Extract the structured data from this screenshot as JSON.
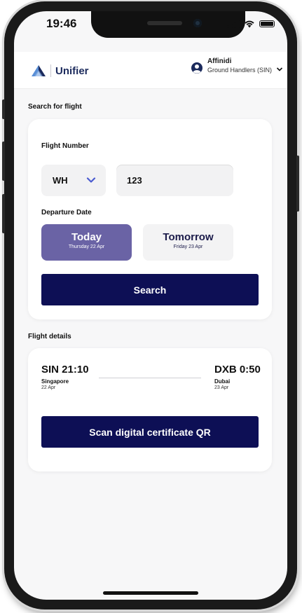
{
  "status_bar": {
    "time": "19:46"
  },
  "header": {
    "brand": "Unifier",
    "user_name": "Affinidi",
    "user_role": "Ground Handlers (SIN)"
  },
  "search": {
    "section_title": "Search for flight",
    "flight_number_label": "Flight Number",
    "airline_code": "WH",
    "flight_number_value": "123",
    "departure_date_label": "Departure Date",
    "date_options": [
      {
        "label": "Today",
        "sub": "Thursday 22 Apr",
        "selected": true
      },
      {
        "label": "Tomorrow",
        "sub": "Friday 23 Apr",
        "selected": false
      }
    ],
    "search_button": "Search"
  },
  "flight_details": {
    "section_title": "Flight details",
    "origin": {
      "code_time": "SIN 21:10",
      "city": "Singapore",
      "date": "22 Apr"
    },
    "destination": {
      "code_time": "DXB 0:50",
      "city": "Dubai",
      "date": "23 Apr"
    },
    "scan_button": "Scan digital certificate QR"
  },
  "colors": {
    "primary": "#0d0f55",
    "selected_date": "#6a63a5",
    "brand_text": "#1b2a5c",
    "accent_chevron": "#4a5bd0"
  }
}
